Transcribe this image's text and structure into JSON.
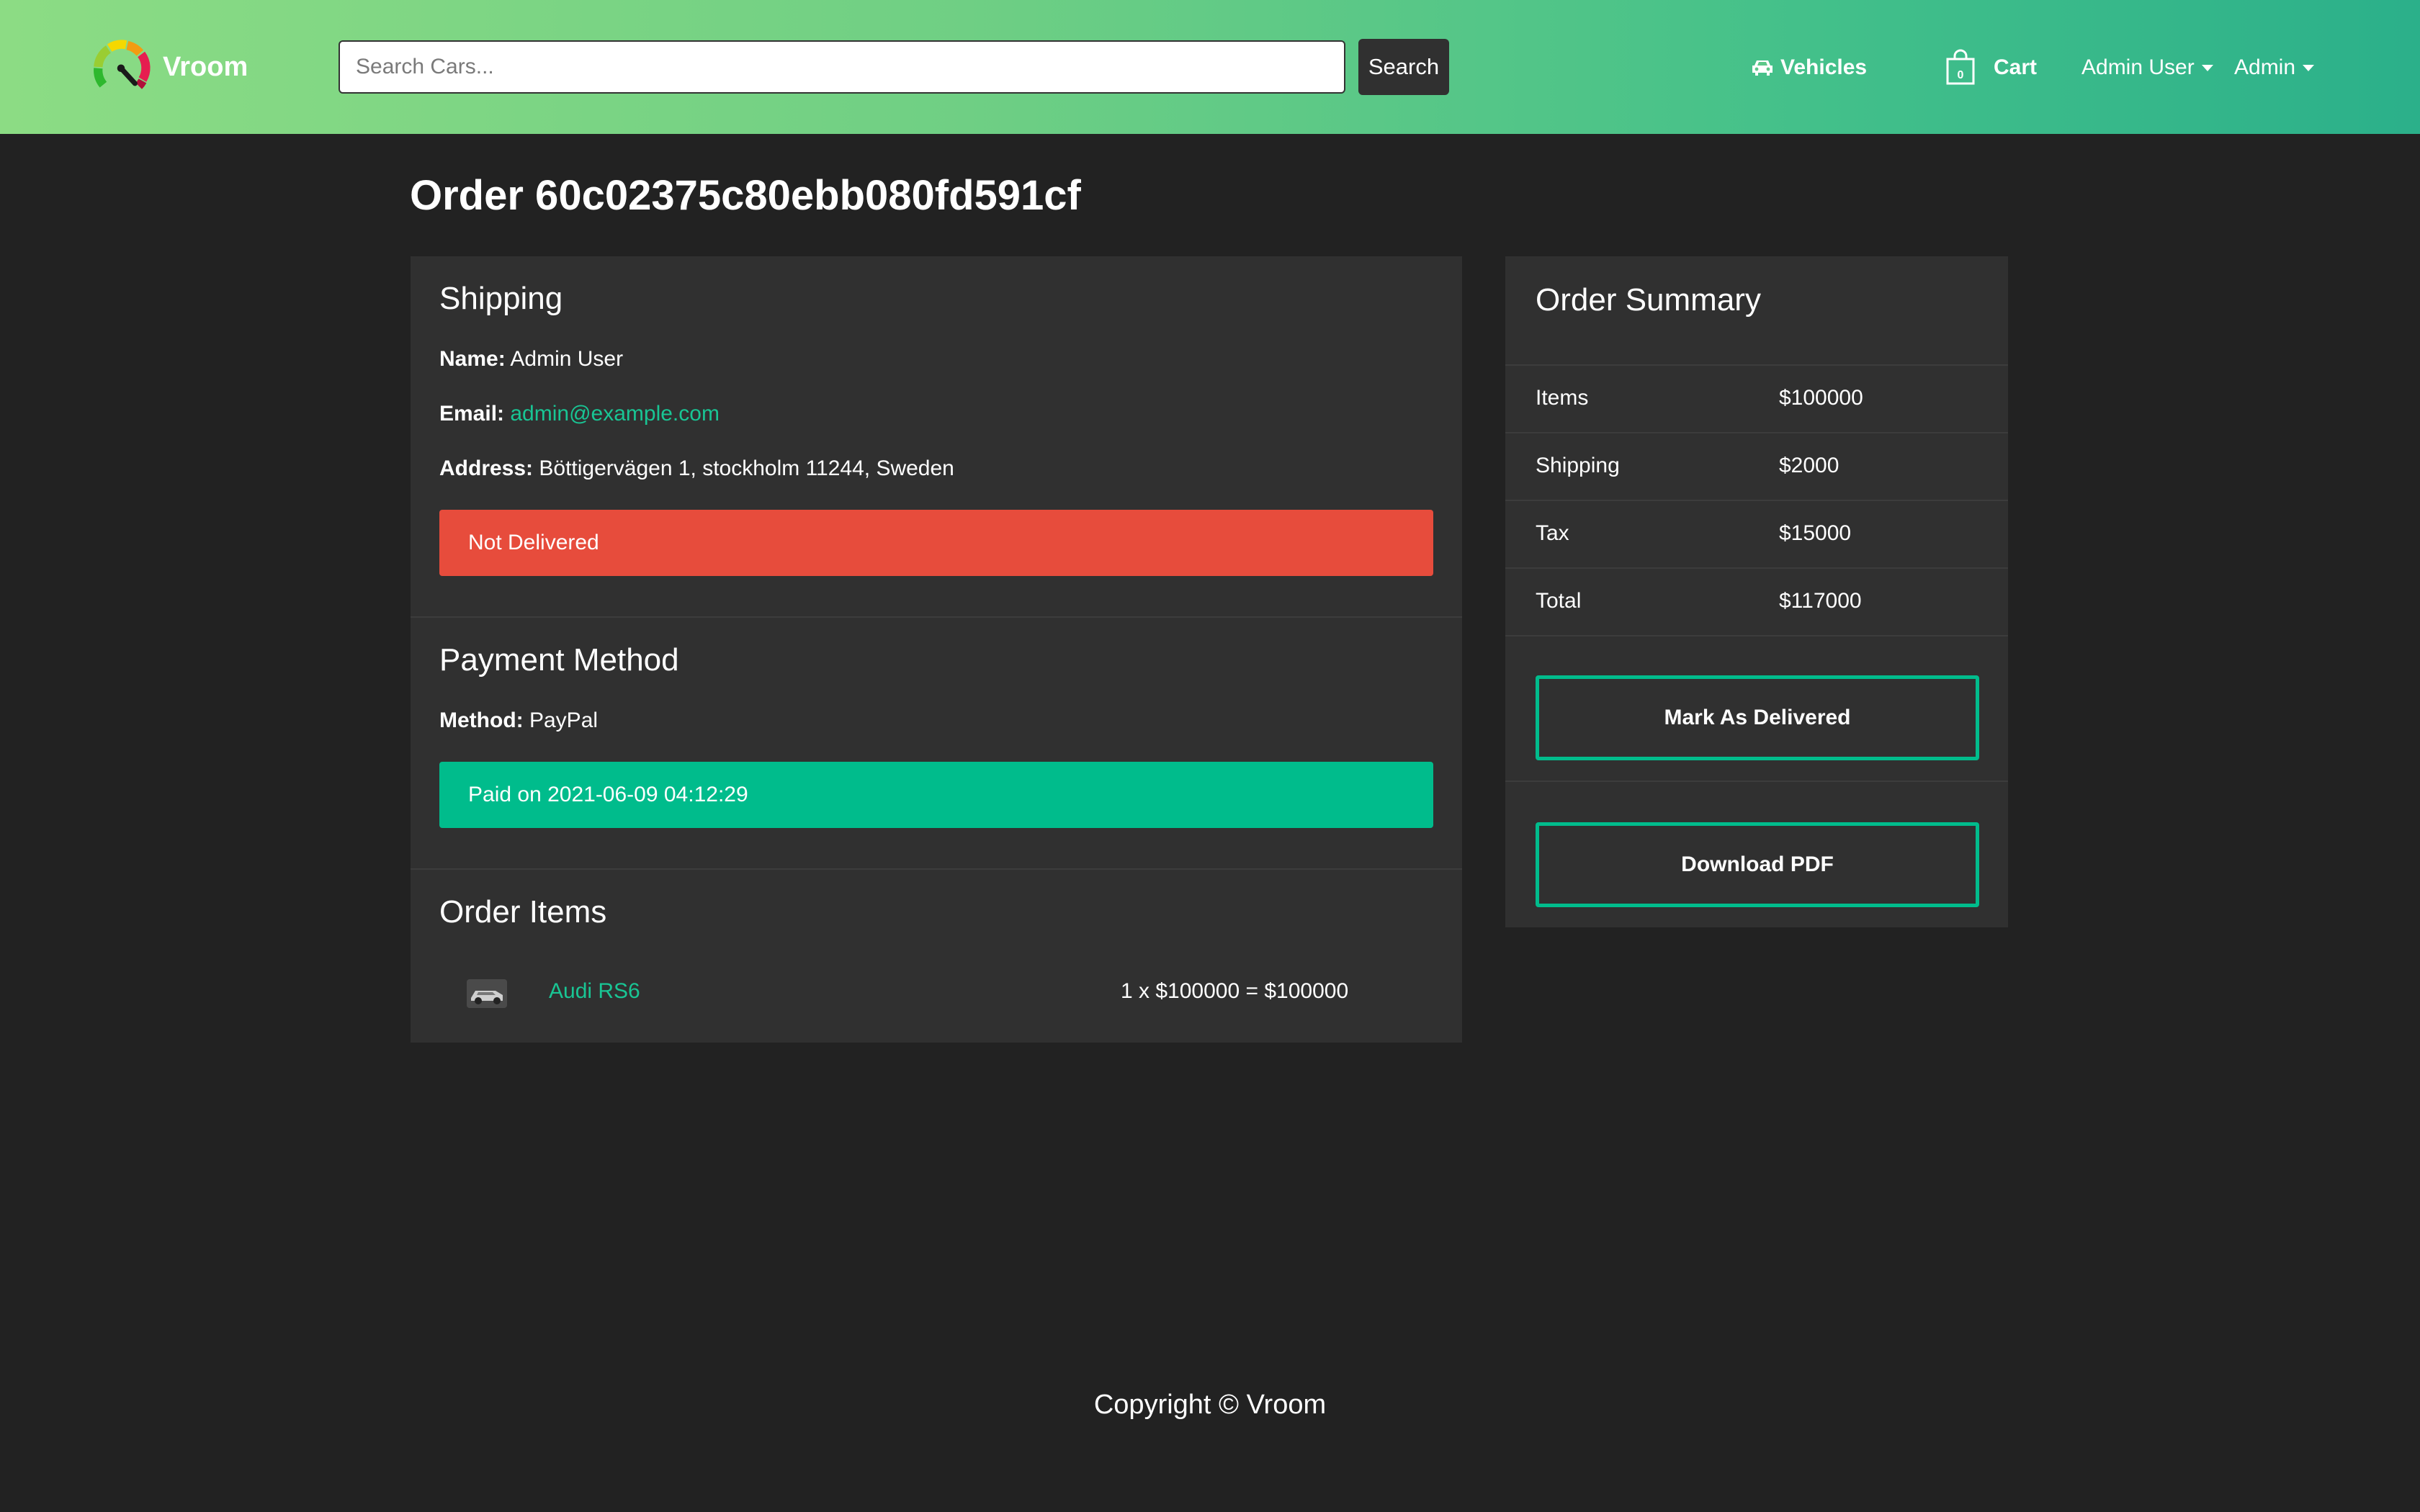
{
  "colors": {
    "background": "#222222",
    "card": "#303030",
    "accent": "#00bc8c",
    "danger": "#e74c3c",
    "link": "#19c594",
    "navbar_gradient": [
      "#8cdc84",
      "#2bb08a"
    ]
  },
  "navbar": {
    "brand": "Vroom",
    "search_placeholder": "Search Cars...",
    "search_value": "",
    "search_button": "Search",
    "vehicles_label": "Vehicles",
    "cart_label": "Cart",
    "cart_count": "0",
    "user_menu": "Admin User",
    "admin_menu": "Admin",
    "icons": [
      "speedometer-logo",
      "car-icon",
      "shopping-bag-icon",
      "caret-down-icon"
    ]
  },
  "page": {
    "title": "Order 60c02375c80ebb080fd591cf"
  },
  "shipping": {
    "heading": "Shipping",
    "name_label": "Name:",
    "name": "Admin User",
    "email_label": "Email:",
    "email": "admin@example.com",
    "address_label": "Address:",
    "address": "Böttigervägen 1, stockholm 11244, Sweden",
    "status": "Not Delivered"
  },
  "payment": {
    "heading": "Payment Method",
    "method_label": "Method:",
    "method": "PayPal",
    "status": "Paid on 2021-06-09 04:12:29"
  },
  "order_items": {
    "heading": "Order Items",
    "items": [
      {
        "name": "Audi RS6",
        "calc": "1 x $100000 = $100000",
        "thumbnail": "car-thumbnail"
      }
    ]
  },
  "summary": {
    "heading": "Order Summary",
    "rows": [
      {
        "label": "Items",
        "value": "$100000"
      },
      {
        "label": "Shipping",
        "value": "$2000"
      },
      {
        "label": "Tax",
        "value": "$15000"
      },
      {
        "label": "Total",
        "value": "$117000"
      }
    ],
    "mark_delivered_button": "Mark As Delivered",
    "download_pdf_button": "Download PDF"
  },
  "footer": {
    "text": "Copyright © Vroom"
  }
}
